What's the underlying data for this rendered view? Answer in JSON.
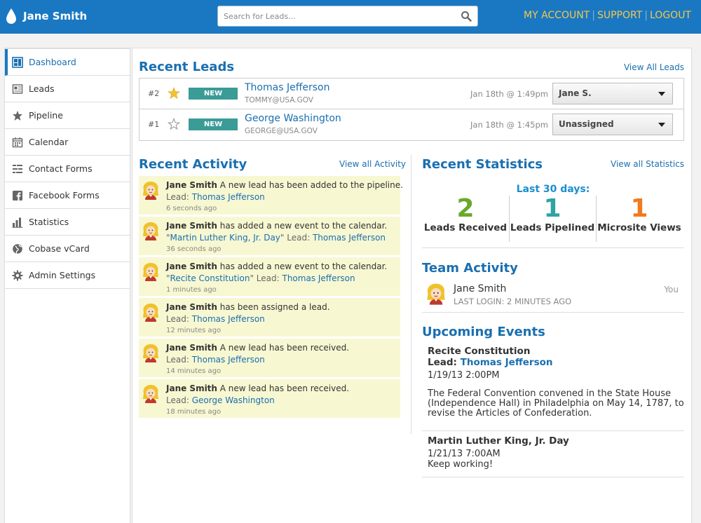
{
  "header": {
    "user_name": "Jane Smith",
    "search_placeholder": "Search for Leads...",
    "links": [
      "MY ACCOUNT",
      "SUPPORT",
      "LOGOUT"
    ]
  },
  "sidebar": {
    "items": [
      {
        "label": "Dashboard",
        "icon": "dashboard-icon",
        "active": true
      },
      {
        "label": "Leads",
        "icon": "leads-icon"
      },
      {
        "label": "Pipeline",
        "icon": "star-icon"
      },
      {
        "label": "Calendar",
        "icon": "calendar-icon"
      },
      {
        "label": "Contact Forms",
        "icon": "form-icon"
      },
      {
        "label": "Facebook Forms",
        "icon": "facebook-icon"
      },
      {
        "label": "Statistics",
        "icon": "bar-chart-icon"
      },
      {
        "label": "Cobase vCard",
        "icon": "globe-icon"
      },
      {
        "label": "Admin Settings",
        "icon": "gear-icon"
      }
    ]
  },
  "recent_leads": {
    "title": "Recent Leads",
    "view_all": "View All Leads",
    "rows": [
      {
        "rank": "#2",
        "starred": true,
        "badge": "NEW",
        "name": "Thomas Jefferson",
        "email": "TOMMY@USA.GOV",
        "date": "Jan 18th @ 1:49pm",
        "assignee": "Jane S."
      },
      {
        "rank": "#1",
        "starred": false,
        "badge": "NEW",
        "name": "George Washington",
        "email": "GEORGE@USA.GOV",
        "date": "Jan 18th @ 1:45pm",
        "assignee": "Unassigned"
      }
    ]
  },
  "recent_activity": {
    "title": "Recent Activity",
    "view_all": "View all Activity",
    "items": [
      {
        "actor": "Jane Smith",
        "text": " A new lead has been added to the pipeline.",
        "pre": "Lead: ",
        "event": "",
        "lead": "Thomas Jefferson",
        "time": "6 seconds ago"
      },
      {
        "actor": "Jane Smith",
        "text": " has added a new event to the calendar.",
        "pre": "\"",
        "event": "Martin Luther King, Jr. Day",
        "mid": "\" Lead: ",
        "lead": "Thomas Jefferson",
        "time": "36 seconds ago"
      },
      {
        "actor": "Jane Smith",
        "text": " has added a new event to the calendar.",
        "pre": "\"",
        "event": "Recite Constitution",
        "mid": "\" Lead: ",
        "lead": "Thomas Jefferson",
        "time": "1 minutes ago"
      },
      {
        "actor": "Jane Smith",
        "text": " has been assigned a lead.",
        "pre": "Lead: ",
        "event": "",
        "lead": "Thomas Jefferson",
        "time": "12 minutes ago"
      },
      {
        "actor": "Jane Smith",
        "text": " A new lead has been received.",
        "pre": "Lead: ",
        "event": "",
        "lead": "Thomas Jefferson",
        "time": "14 minutes ago"
      },
      {
        "actor": "Jane Smith",
        "text": " A new lead has been received.",
        "pre": "Lead: ",
        "event": "",
        "lead": "George Washington",
        "time": "18 minutes ago"
      }
    ]
  },
  "recent_statistics": {
    "title": "Recent Statistics",
    "view_all": "View all Statistics",
    "period": "Last 30 days:",
    "stats": [
      {
        "value": "2",
        "label": "Leads Received",
        "color": "#6aa82b"
      },
      {
        "value": "1",
        "label": "Leads Pipelined",
        "color": "#2ea3a3"
      },
      {
        "value": "1",
        "label": "Microsite Views",
        "color": "#f07a1e"
      }
    ]
  },
  "team_activity": {
    "title": "Team Activity",
    "member": {
      "name": "Jane Smith",
      "last_login": "LAST LOGIN: 2 MINUTES AGO",
      "tag": "You"
    }
  },
  "upcoming_events": {
    "title": "Upcoming Events",
    "events": [
      {
        "title": "Recite Constitution",
        "lead_label": "Lead:",
        "lead": "Thomas Jefferson",
        "datetime": "1/19/13 2:00PM",
        "description": "The Federal Convention convened in the State House (Independence Hall) in Philadelphia on May 14, 1787, to revise the Articles of Confederation."
      },
      {
        "title": "Martin Luther King, Jr. Day",
        "datetime": "1/21/13 7:00AM",
        "description": "Keep working!"
      }
    ]
  }
}
